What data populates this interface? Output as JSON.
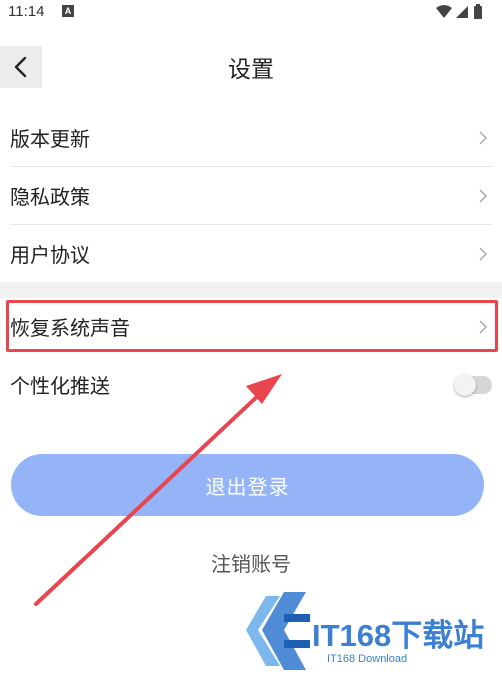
{
  "status_bar": {
    "time": "11:14",
    "notification_letter": "A",
    "icons": [
      "wifi-icon",
      "signal-icon",
      "battery-icon"
    ]
  },
  "header": {
    "title": "设置",
    "back_icon": "chevron-left-icon"
  },
  "settings": {
    "items": [
      {
        "label": "版本更新",
        "icon": "chevron-right-icon"
      },
      {
        "label": "隐私政策",
        "icon": "chevron-right-icon"
      },
      {
        "label": "用户协议",
        "icon": "chevron-right-icon"
      },
      {
        "label": "恢复系统声音",
        "icon": "chevron-right-icon",
        "highlighted": true
      },
      {
        "label": "个性化推送",
        "toggle_on": false
      }
    ]
  },
  "actions": {
    "logout_label": "退出登录",
    "cancel_account_label": "注销账号"
  },
  "watermark": {
    "brand_text": "IT168下载站",
    "sub_text": "IT168 Download"
  },
  "colors": {
    "logout_button": "#94b4f7",
    "highlight_border": "#e8454f",
    "annotation_arrow": "#e8454f",
    "watermark_blue": "#3d7fd1"
  }
}
